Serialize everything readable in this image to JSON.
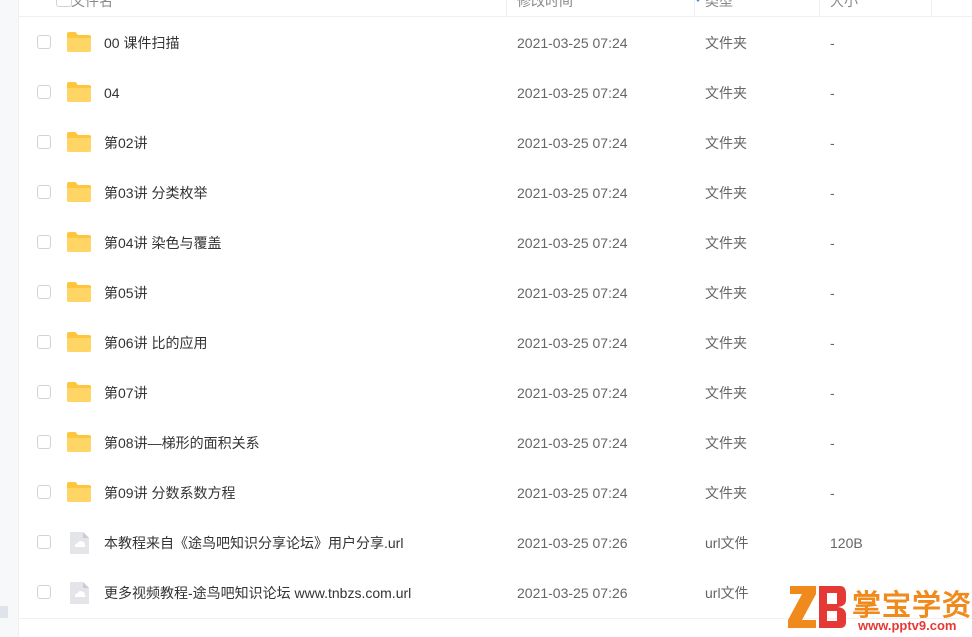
{
  "header": {
    "name": "文件名",
    "modified": "修改时间",
    "type": "类型",
    "size": "大小"
  },
  "rows": [
    {
      "name": "00 课件扫描",
      "modified": "2021-03-25 07:24",
      "type": "文件夹",
      "size": "-",
      "icon": "folder-icon"
    },
    {
      "name": "04",
      "modified": "2021-03-25 07:24",
      "type": "文件夹",
      "size": "-",
      "icon": "folder-icon"
    },
    {
      "name": "第02讲",
      "modified": "2021-03-25 07:24",
      "type": "文件夹",
      "size": "-",
      "icon": "folder-icon"
    },
    {
      "name": "第03讲 分类枚举",
      "modified": "2021-03-25 07:24",
      "type": "文件夹",
      "size": "-",
      "icon": "folder-icon"
    },
    {
      "name": "第04讲 染色与覆盖",
      "modified": "2021-03-25 07:24",
      "type": "文件夹",
      "size": "-",
      "icon": "folder-icon"
    },
    {
      "name": "第05讲",
      "modified": "2021-03-25 07:24",
      "type": "文件夹",
      "size": "-",
      "icon": "folder-icon"
    },
    {
      "name": "第06讲 比的应用",
      "modified": "2021-03-25 07:24",
      "type": "文件夹",
      "size": "-",
      "icon": "folder-icon"
    },
    {
      "name": "第07讲",
      "modified": "2021-03-25 07:24",
      "type": "文件夹",
      "size": "-",
      "icon": "folder-icon"
    },
    {
      "name": "第08讲—梯形的面积关系",
      "modified": "2021-03-25 07:24",
      "type": "文件夹",
      "size": "-",
      "icon": "folder-icon"
    },
    {
      "name": "第09讲 分数系数方程",
      "modified": "2021-03-25 07:24",
      "type": "文件夹",
      "size": "-",
      "icon": "folder-icon"
    },
    {
      "name": "本教程来自《途鸟吧知识分享论坛》用户分享.url",
      "modified": "2021-03-25 07:26",
      "type": "url文件",
      "size": "120B",
      "icon": "url-file-icon"
    },
    {
      "name": "更多视频教程-途鸟吧知识论坛 www.tnbzs.com.url",
      "modified": "2021-03-25 07:26",
      "type": "url文件",
      "size": "",
      "icon": "url-file-icon"
    }
  ],
  "watermark": {
    "text": "掌宝学资网",
    "url": "www.pptv9.com"
  },
  "colors": {
    "folder": "#FFC53D",
    "accent": "#3A8EE6",
    "watermark_orange": "#F08A1C",
    "watermark_red": "#E53935"
  }
}
